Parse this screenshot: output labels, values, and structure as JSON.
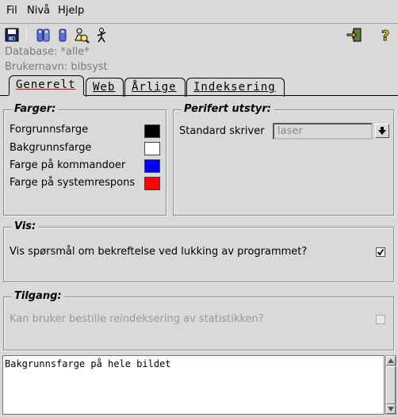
{
  "menu": {
    "file_label": "Fil",
    "level_label": "Nivå",
    "help_label": "Hjelp"
  },
  "toolbar": {
    "icons": [
      "save-icon",
      "user-group-icon",
      "user-icon",
      "user-search-icon",
      "walking-person-icon",
      "exit-door-icon",
      "help-icon"
    ]
  },
  "info": {
    "database": "Database: *alle*",
    "username": "Brukernavn: bibsyst"
  },
  "tabs": [
    {
      "label": "Generelt",
      "active": true
    },
    {
      "label": "Web",
      "active": false
    },
    {
      "label": "Årlige",
      "active": false
    },
    {
      "label": "Indeksering",
      "active": false
    }
  ],
  "colors": {
    "title": "Farger:",
    "items": [
      {
        "label": "Forgrunnsfarge",
        "color": "#000000"
      },
      {
        "label": "Bakgrunnsfarge",
        "color": "#ffffff"
      },
      {
        "label": "Farge på kommandoer",
        "color": "#0000ff"
      },
      {
        "label": "Farge på systemrespons",
        "color": "#ff0000"
      }
    ]
  },
  "peripheral": {
    "title": "Perifert utstyr:",
    "printer_label": "Standard skriver",
    "printer_value": "laser"
  },
  "show": {
    "title": "Vis:",
    "confirm_label": "Vis spørsmål om bekreftelse ved lukking av programmet?",
    "confirm_checked": true
  },
  "access": {
    "title": "Tilgang:",
    "reindex_label": "Kan bruker bestille reindeksering av statistikken?",
    "reindex_checked": false
  },
  "status": {
    "text": "Bakgrunnsfarge på hele bildet"
  }
}
